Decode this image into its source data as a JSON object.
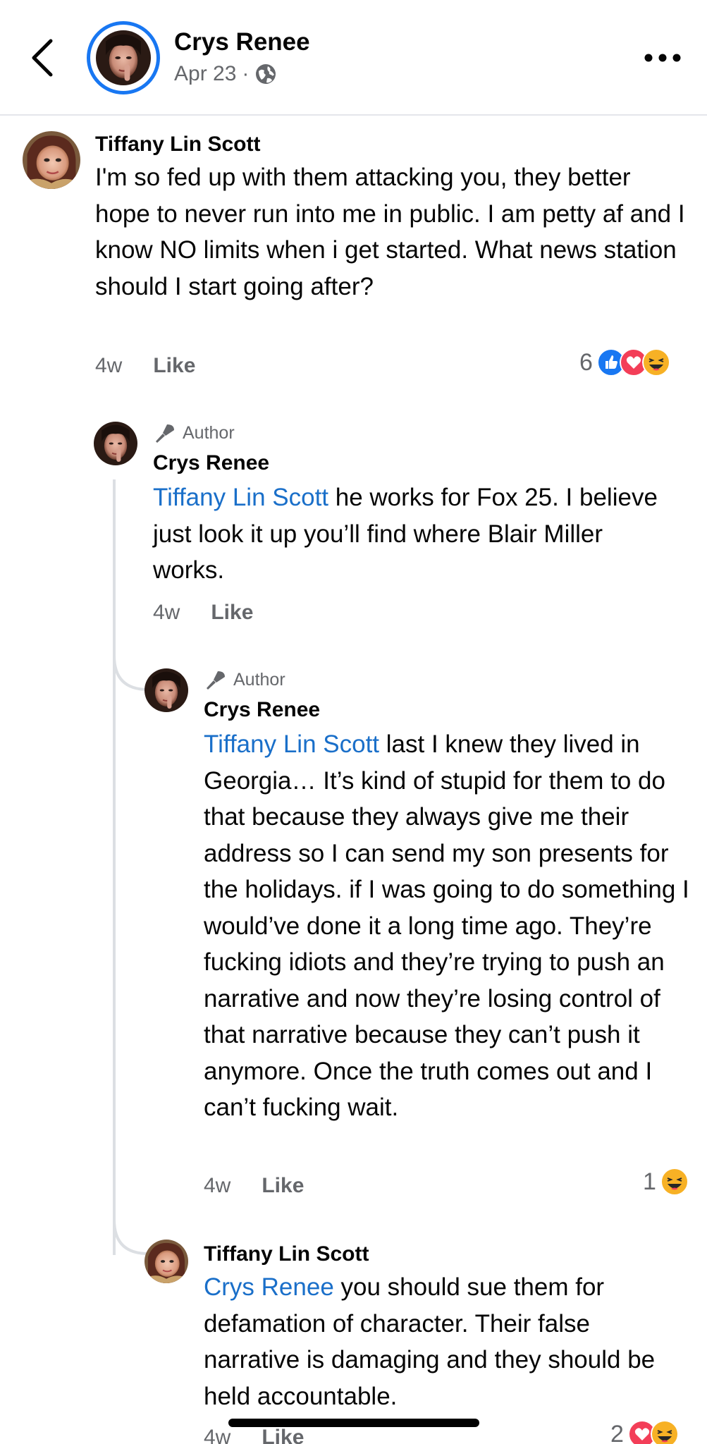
{
  "header": {
    "name": "Crys Renee",
    "date": "Apr 23",
    "separator": "·"
  },
  "comments": [
    {
      "name": "Tiffany Lin Scott",
      "text": "I'm so fed up with them attacking you, they better hope to never run into me in public. I am petty af and I know NO limits when i get started. What news station should I start going after?",
      "time": "4w",
      "like": "Like",
      "reaction_count": "6",
      "reactions": [
        "like",
        "love",
        "haha"
      ]
    },
    {
      "badge": "Author",
      "name": "Crys Renee",
      "mention": "Tiffany Lin Scott",
      "text": " he works for Fox 25. I believe just look it up you’ll find where Blair Miller works.",
      "time": "4w",
      "like": "Like"
    },
    {
      "badge": "Author",
      "name": "Crys Renee",
      "mention": "Tiffany Lin Scott",
      "text": " last I knew they lived in Georgia… It’s kind of stupid for them to do that because they always give me their address so I can send my son presents for the holidays. if I was going to do something I would’ve done it a long time ago. They’re fucking idiots and they’re trying to push an narrative and now they’re losing control of that narrative because they can’t push it anymore. Once the truth comes out and I can’t fucking wait.",
      "time": "4w",
      "like": "Like",
      "reaction_count": "1",
      "reactions": [
        "haha"
      ]
    },
    {
      "name": "Tiffany Lin Scott",
      "mention": "Crys Renee",
      "text": " you should sue them for defamation of character. Their false narrative is damaging and they should be held accountable.",
      "time": "4w",
      "like": "Like",
      "reaction_count": "2",
      "reactions": [
        "love",
        "haha"
      ]
    }
  ],
  "colors": {
    "accent": "#1877f2",
    "mention": "#1a6fc9",
    "meta": "#65676b",
    "like_reaction": "#1877f2",
    "love_reaction": "#f33e58",
    "haha_reaction": "#f7b125"
  }
}
